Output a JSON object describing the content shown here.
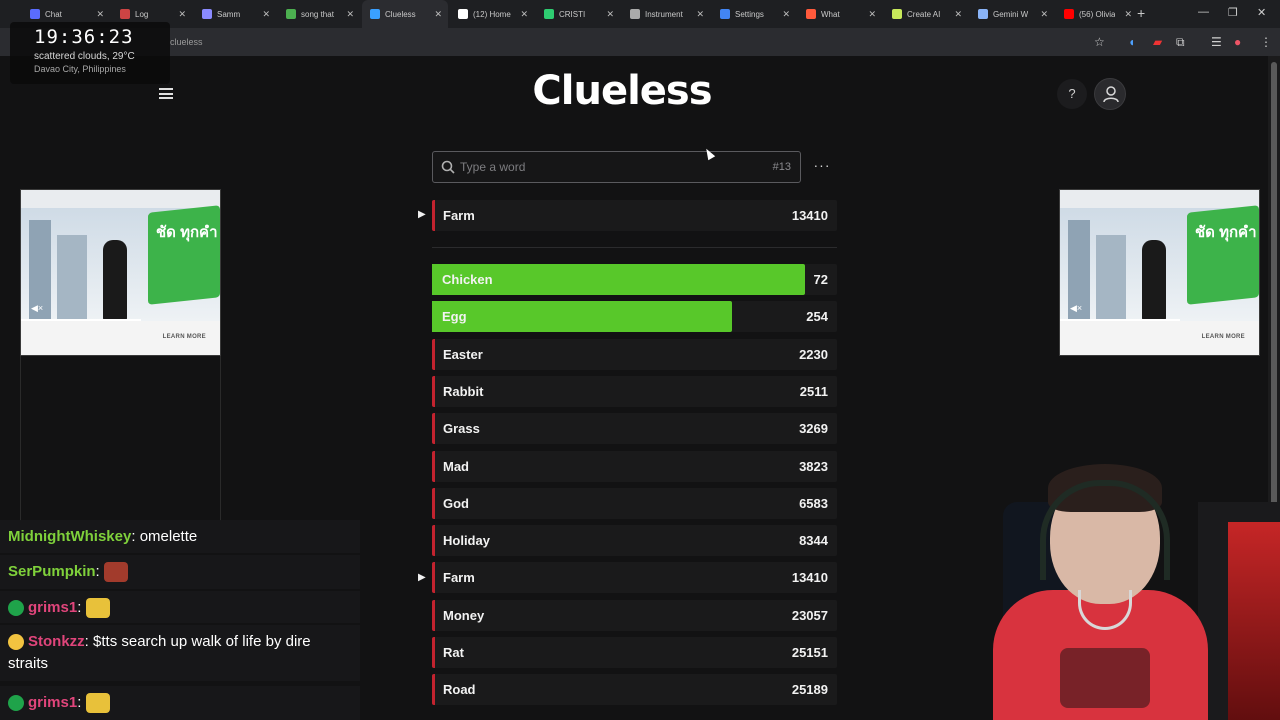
{
  "browser": {
    "tabs": [
      {
        "label": "Chat",
        "color": "#5a6cff"
      },
      {
        "label": "Log",
        "color": "#c44"
      },
      {
        "label": "Samm",
        "color": "#8a8aff"
      },
      {
        "label": "song that",
        "color": "#4caf50"
      },
      {
        "label": "Clueless",
        "color": "#3aa0ff"
      },
      {
        "label": "(12) Home",
        "color": "#ffffff"
      },
      {
        "label": "CRISTI",
        "color": "#2ecc71"
      },
      {
        "label": "Instrument",
        "color": "#aaaaaa"
      },
      {
        "label": "Settings",
        "color": "#4285f4"
      },
      {
        "label": "What",
        "color": "#ff5a3c"
      },
      {
        "label": "Create AI",
        "color": "#c7e85a"
      },
      {
        "label": "Gemini W",
        "color": "#8ab4f8"
      },
      {
        "label": "(56) Olivia",
        "color": "#ff0000"
      }
    ],
    "url": "clueless"
  },
  "clock": {
    "time": "19:36:23",
    "weather": "scattered clouds, 29°C",
    "location": "Davao City, Philippines"
  },
  "game": {
    "title": "Clueless",
    "search_placeholder": "Type a word",
    "game_number": "#13",
    "help_label": "?",
    "more_label": "···",
    "last_guess": {
      "word": "Farm",
      "rank": "13410"
    },
    "guesses": [
      {
        "word": "Chicken",
        "rank": "72",
        "fill": 0.92,
        "color": "#58c82a"
      },
      {
        "word": "Egg",
        "rank": "254",
        "fill": 0.74,
        "color": "#58c82a"
      },
      {
        "word": "Easter",
        "rank": "2230"
      },
      {
        "word": "Rabbit",
        "rank": "2511"
      },
      {
        "word": "Grass",
        "rank": "3269"
      },
      {
        "word": "Mad",
        "rank": "3823"
      },
      {
        "word": "God",
        "rank": "6583"
      },
      {
        "word": "Holiday",
        "rank": "8344"
      },
      {
        "word": "Farm",
        "rank": "13410"
      },
      {
        "word": "Money",
        "rank": "23057"
      },
      {
        "word": "Rat",
        "rank": "25151"
      },
      {
        "word": "Road",
        "rank": "25189"
      }
    ]
  },
  "ads": {
    "box_text": "ชัด ทุกคำ",
    "learn_more": "LEARN MORE"
  },
  "chat": [
    {
      "user": "MidnightWhiskey",
      "text": "omelette",
      "user_color": "#7fd13b"
    },
    {
      "user": "SerPumpkin",
      "text": "",
      "user_color": "#7fd13b"
    },
    {
      "user": "grims1",
      "text": "",
      "user_color": "#e0457b"
    },
    {
      "user": "Stonkzz",
      "text": "$tts search up walk of life by dire straits",
      "user_color": "#e0457b"
    },
    {
      "user": "grims1",
      "text": "",
      "user_color": "#e0457b"
    }
  ]
}
